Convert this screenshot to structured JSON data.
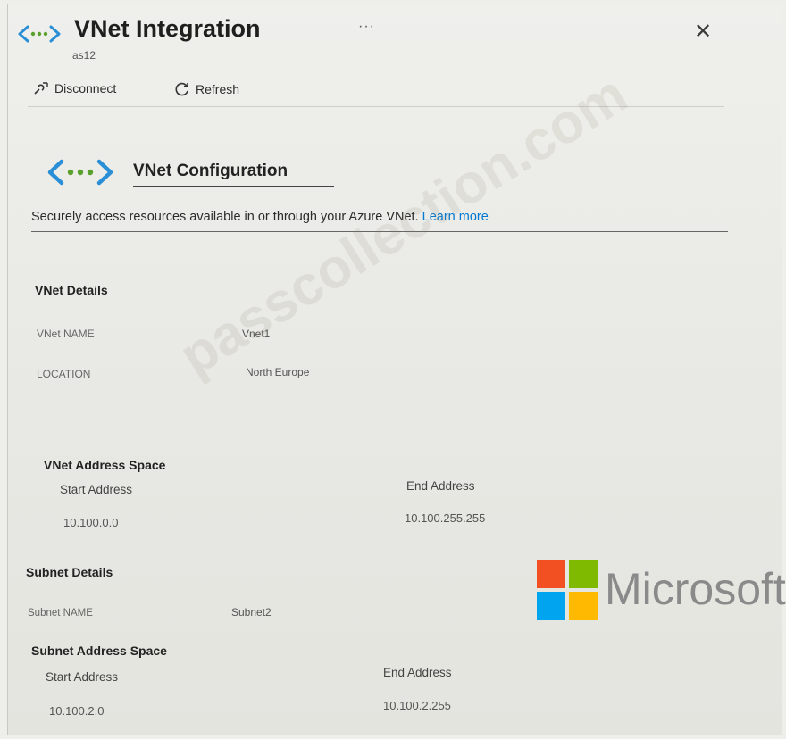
{
  "header": {
    "title": "VNet Integration",
    "subtitle": "as12",
    "more_label": "···",
    "close_label": "✕"
  },
  "toolbar": {
    "disconnect_label": "Disconnect",
    "refresh_label": "Refresh"
  },
  "config": {
    "title": "VNet Configuration",
    "description": "Securely access resources available in or through your Azure VNet.",
    "learn_more": "Learn more"
  },
  "vnet_details": {
    "heading": "VNet Details",
    "name_label": "VNet NAME",
    "name_value": "Vnet1",
    "location_label": "LOCATION",
    "location_value": "North Europe"
  },
  "vnet_address_space": {
    "heading": "VNet Address Space",
    "start_label": "Start Address",
    "end_label": "End Address",
    "start_value": "10.100.0.0",
    "end_value": "10.100.255.255"
  },
  "subnet_details": {
    "heading": "Subnet Details",
    "name_label": "Subnet NAME",
    "name_value": "Subnet2"
  },
  "subnet_address_space": {
    "heading": "Subnet Address Space",
    "start_label": "Start Address",
    "end_label": "End Address",
    "start_value": "10.100.2.0",
    "end_value": "10.100.2.255"
  },
  "watermark": "passcollection.com",
  "brand": "Microsoft",
  "icons": {
    "vnet": "vnet-icon",
    "disconnect": "disconnect-icon",
    "refresh": "refresh-icon"
  },
  "colors": {
    "accent": "#0078d4",
    "ms_red": "#f25022",
    "ms_green": "#7fba00",
    "ms_blue": "#00a4ef",
    "ms_yellow": "#ffb900"
  }
}
